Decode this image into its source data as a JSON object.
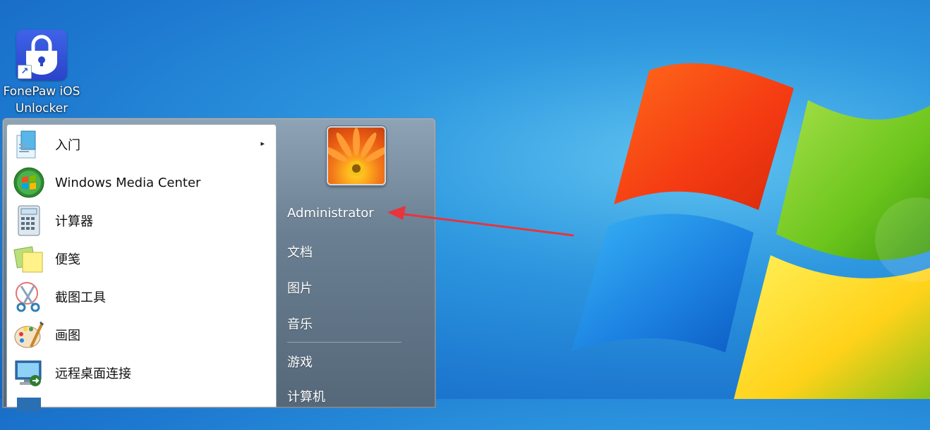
{
  "desktop": {
    "icons": [
      {
        "label_line1": "FonePaw iOS",
        "label_line2": "Unlocker",
        "icon": "fonepaw-lock-icon"
      }
    ]
  },
  "start_menu": {
    "programs": [
      {
        "label": "入门",
        "icon": "getting-started-icon",
        "has_submenu": true
      },
      {
        "label": "Windows Media Center",
        "icon": "windows-media-center-icon"
      },
      {
        "label": "计算器",
        "icon": "calculator-icon"
      },
      {
        "label": "便笺",
        "icon": "sticky-notes-icon"
      },
      {
        "label": "截图工具",
        "icon": "snipping-tool-icon"
      },
      {
        "label": "画图",
        "icon": "paint-icon"
      },
      {
        "label": "远程桌面连接",
        "icon": "remote-desktop-icon"
      }
    ],
    "submenu_arrow": "▸",
    "right": {
      "user": "Administrator",
      "items": [
        "文档",
        "图片",
        "音乐",
        "游戏",
        "计算机"
      ]
    }
  },
  "colors": {
    "desktop_blue": "#1d78cf",
    "annotation_arrow": "#e8343c"
  }
}
